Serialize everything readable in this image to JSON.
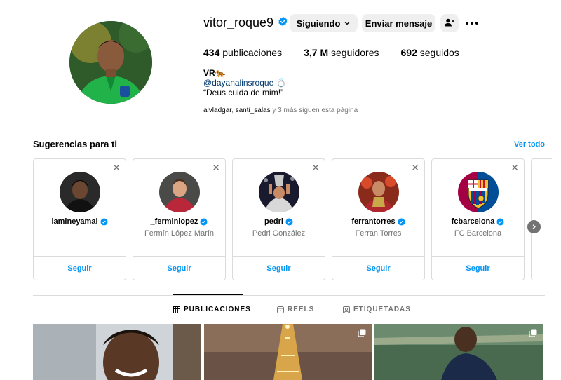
{
  "profile": {
    "username": "vitor_roque9",
    "following_button": "Siguiendo",
    "message_button": "Enviar mensaje",
    "stats": {
      "posts_count": "434",
      "posts_label": "publicaciones",
      "followers_count": "3,7 M",
      "followers_label": "seguidores",
      "following_count": "692",
      "following_label": "seguidos"
    },
    "full_name": "VR🐅",
    "bio_link": "@dayanalinsroque 💍",
    "bio_text": "“Deus cuida de mim!”",
    "followed_by": {
      "user1": "alvladgar",
      "separator": ", ",
      "user2": "santi_salas",
      "suffix": " y 3 más siguen esta página"
    }
  },
  "suggestions": {
    "title": "Sugerencias para ti",
    "see_all": "Ver todo",
    "close_glyph": "✕",
    "items": [
      {
        "username": "lamineyamal",
        "name": "",
        "follow": "Seguir"
      },
      {
        "username": "_ferminlopez",
        "name": "Fermín López Marín",
        "follow": "Seguir"
      },
      {
        "username": "pedri",
        "name": "Pedri González",
        "follow": "Seguir"
      },
      {
        "username": "ferrantorres",
        "name": "Ferran Torres",
        "follow": "Seguir"
      },
      {
        "username": "fcbarcelona",
        "name": "FC Barcelona",
        "follow": "Seguir"
      }
    ]
  },
  "tabs": [
    {
      "label": "PUBLICACIONES",
      "active": true
    },
    {
      "label": "REELS",
      "active": false
    },
    {
      "label": "ETIQUETADAS",
      "active": false
    }
  ],
  "colors": {
    "accent": "#0095f6",
    "link": "#00376b",
    "secondary_text": "#737373",
    "button_bg": "#efefef",
    "border": "#dbdbdb"
  }
}
